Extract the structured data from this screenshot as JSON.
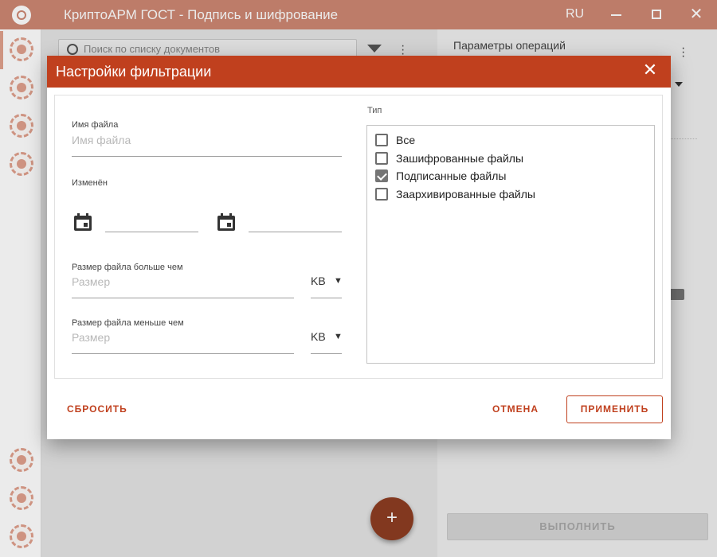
{
  "window": {
    "title": "КриптоАРМ ГОСТ - Подпись и шифрование",
    "lang": "RU",
    "close_glyph": "✕"
  },
  "rail": {
    "icons": [
      "sign-icon",
      "documents-icon",
      "certificates-icon",
      "contacts-icon",
      "cloud-icon",
      "journal-icon",
      "exit-icon"
    ]
  },
  "background": {
    "search_placeholder": "Поиск по списку документов",
    "params_title": "Параметры операций",
    "run_button": "ВЫПОЛНИТЬ",
    "fab_glyph": "+"
  },
  "dialog": {
    "title": "Настройки фильтрации",
    "close_glyph": "✕",
    "filename": {
      "label": "Имя файла",
      "placeholder": "Имя файла"
    },
    "modified": {
      "label": "Изменён"
    },
    "size_more": {
      "label": "Размер файла больше чем",
      "placeholder": "Размер",
      "unit": "KB"
    },
    "size_less": {
      "label": "Размер файла меньше чем",
      "placeholder": "Размер",
      "unit": "KB"
    },
    "caret_glyph": "▼",
    "type": {
      "label": "Тип",
      "options": [
        {
          "label": "Все",
          "checked": false
        },
        {
          "label": "Зашифрованные файлы",
          "checked": false
        },
        {
          "label": "Подписанные файлы",
          "checked": true
        },
        {
          "label": "Заархивированные файлы",
          "checked": false
        }
      ]
    },
    "buttons": {
      "reset": "СБРОСИТЬ",
      "cancel": "ОТМЕНА",
      "apply": "ПРИМЕНИТЬ"
    }
  },
  "colors": {
    "accent": "#c0401e",
    "titlebar": "#ce8772",
    "fab": "#8e3d22"
  }
}
